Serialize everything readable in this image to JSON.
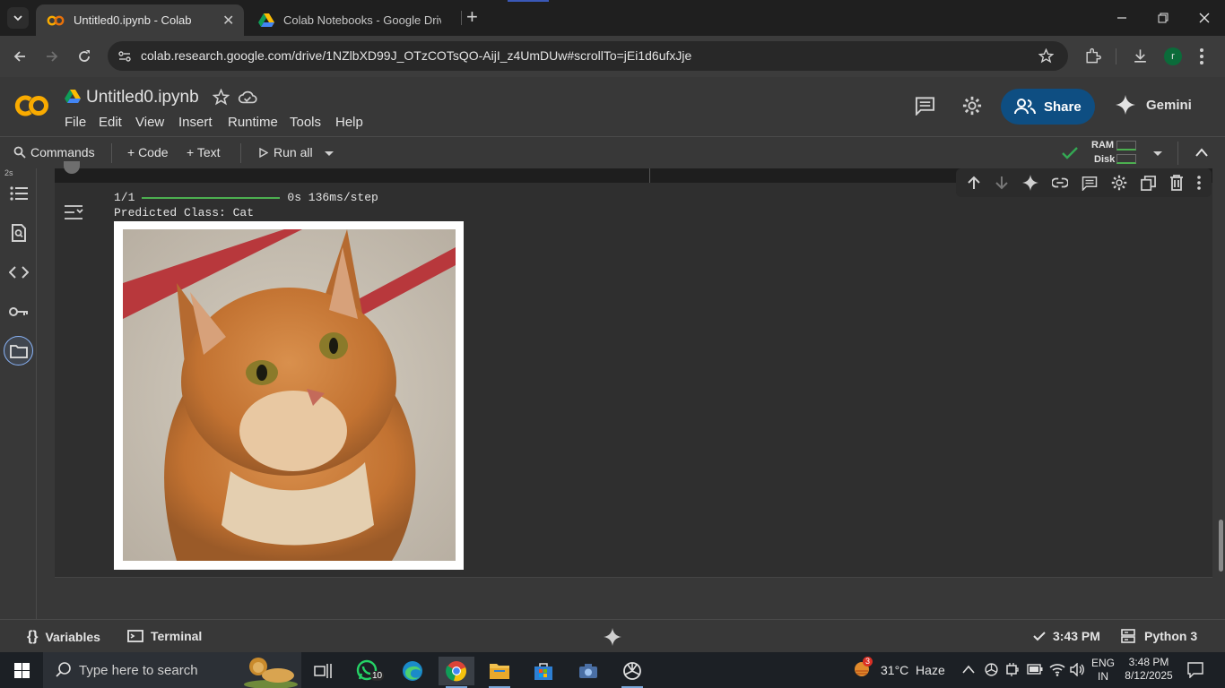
{
  "browser": {
    "tabs": [
      {
        "title": "Untitled0.ipynb - Colab",
        "active": true
      },
      {
        "title": "Colab Notebooks - Google Drive",
        "active": false
      }
    ],
    "url": "colab.research.google.com/drive/1NZlbXD99J_OTzCOTsQO-AijI_z4UmDUw#scrollTo=jEi1d6ufxJje",
    "profile_initial": "r"
  },
  "colab": {
    "notebook_title": "Untitled0.ipynb",
    "menu": [
      "File",
      "Edit",
      "View",
      "Insert",
      "Runtime",
      "Tools",
      "Help"
    ],
    "share_label": "Share",
    "gemini_label": "Gemini",
    "toolbar": {
      "commands": "Commands",
      "code": "+ Code",
      "text": "+ Text",
      "run_all": "Run all"
    },
    "resources": {
      "ram": "RAM",
      "disk": "Disk"
    },
    "cell": {
      "exec_time": "2s",
      "output_progress_step": "1/1",
      "output_progress_time": "0s 136ms/step",
      "output_prediction": "Predicted Class: Cat"
    },
    "statusbar": {
      "variables": "Variables",
      "terminal": "Terminal",
      "last_run": "3:43 PM",
      "runtime": "Python 3"
    }
  },
  "taskbar": {
    "search_placeholder": "Type here to search",
    "whatsapp_badge": "10",
    "weather_badge": "3",
    "weather": "31°C  Haze",
    "lang_line1": "ENG",
    "lang_line2": "IN",
    "time": "3:48 PM",
    "date": "8/12/2025"
  },
  "colors": {
    "accent_share": "#0e4e82",
    "colab_orange": "#f9ab00",
    "progress_green": "#4caf50",
    "check_green": "#34a853"
  }
}
